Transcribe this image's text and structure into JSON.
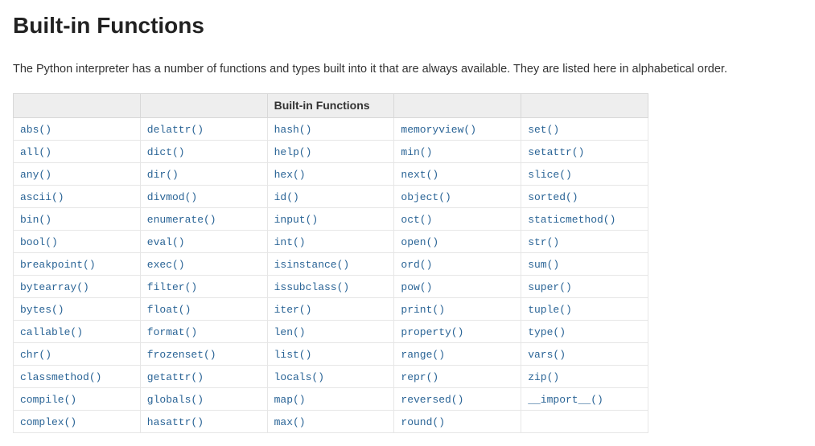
{
  "heading": "Built-in Functions",
  "intro": "The Python interpreter has a number of functions and types built into it that are always available. They are listed here in alphabetical order.",
  "table": {
    "header": {
      "c0": "",
      "c1": "",
      "c2": "Built-in Functions",
      "c3": "",
      "c4": ""
    },
    "columns": [
      [
        "abs()",
        "all()",
        "any()",
        "ascii()",
        "bin()",
        "bool()",
        "breakpoint()",
        "bytearray()",
        "bytes()",
        "callable()",
        "chr()",
        "classmethod()",
        "compile()",
        "complex()"
      ],
      [
        "delattr()",
        "dict()",
        "dir()",
        "divmod()",
        "enumerate()",
        "eval()",
        "exec()",
        "filter()",
        "float()",
        "format()",
        "frozenset()",
        "getattr()",
        "globals()",
        "hasattr()"
      ],
      [
        "hash()",
        "help()",
        "hex()",
        "id()",
        "input()",
        "int()",
        "isinstance()",
        "issubclass()",
        "iter()",
        "len()",
        "list()",
        "locals()",
        "map()",
        "max()"
      ],
      [
        "memoryview()",
        "min()",
        "next()",
        "object()",
        "oct()",
        "open()",
        "ord()",
        "pow()",
        "print()",
        "property()",
        "range()",
        "repr()",
        "reversed()",
        "round()"
      ],
      [
        "set()",
        "setattr()",
        "slice()",
        "sorted()",
        "staticmethod()",
        "str()",
        "sum()",
        "super()",
        "tuple()",
        "type()",
        "vars()",
        "zip()",
        "__import__()",
        ""
      ]
    ]
  }
}
